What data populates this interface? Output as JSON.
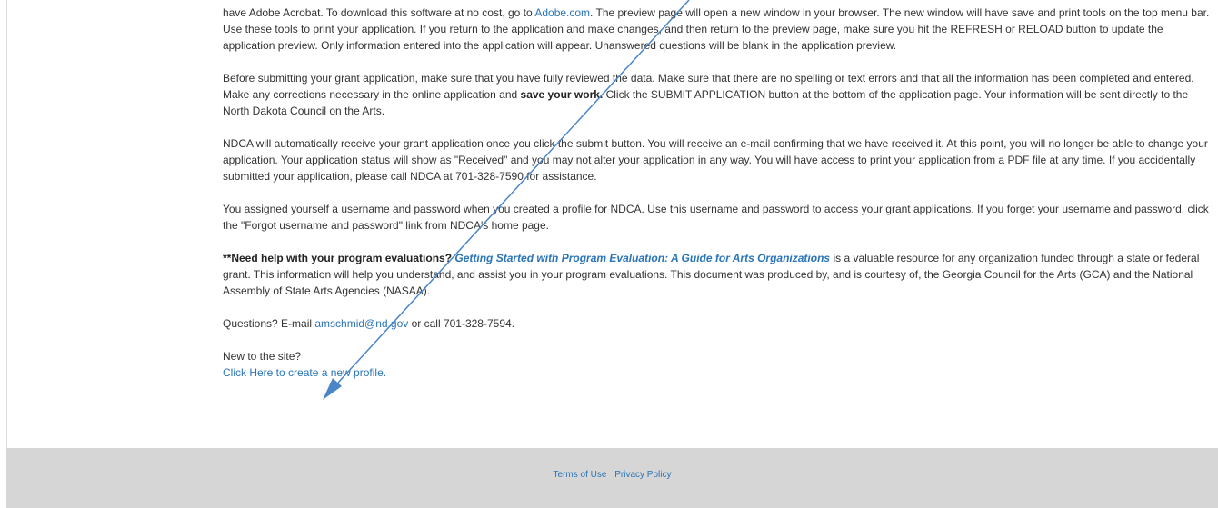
{
  "intro": {
    "p1_a": "have Adobe Acrobat. To download this software at no cost, go to ",
    "p1_link": "Adobe.com",
    "p1_b": ". The preview page will open a new window in your browser. The new window will have save and print tools on the top menu bar. Use these tools to print your application. If you return to the application and make changes, and then return to the preview page, make sure you hit the REFRESH or RELOAD button to update the application preview. Only information entered into the application will appear. Unanswered questions will be blank in the application preview."
  },
  "submit": {
    "p2_a": "Before submitting your grant application, make sure that you have fully reviewed the data. Make sure that there are no spelling or text errors and that all the information has been completed and entered. Make any corrections necessary in the online application and ",
    "p2_bold": "save your work.",
    "p2_b": " Click the SUBMIT APPLICATION button at the bottom of the application page. Your information will be sent directly to the North Dakota Council on the Arts."
  },
  "received": {
    "p3": "NDCA will automatically receive your grant application once you click the submit button. You will receive an e-mail confirming that we have received it. At this point, you will no longer be able to change your application. Your application status will show as \"Received\" and you may not alter your application in any way. You will have access to print your application from a PDF file at any time. If you accidentally submitted your application, please call NDCA at 701-328-7590 for assistance."
  },
  "login": {
    "p4": "You assigned yourself a username and password when you created a profile for NDCA. Use this username and password to access your grant applications. If you forget your username and password, click the \"Forgot username and password\" link from NDCA's home page."
  },
  "evaluation": {
    "p5_bold": "**Need help with your program evaluations?",
    "p5_link": "Getting Started with Program Evaluation: A Guide for Arts Organizations",
    "p5_b": " is a valuable resource for any organization funded through a state or federal grant. This information will help you understand, and assist you in your program evaluations. This document was produced by, and is courtesy of, the Georgia Council for the Arts (GCA) and the National Assembly of State Arts Agencies (NASAA)."
  },
  "questions": {
    "prefix": "Questions? E-mail ",
    "email": "amschmid@nd.gov",
    "suffix": " or call 701-328-7594."
  },
  "new_user": {
    "label": "New to the site?",
    "link": "Click Here to create a new profile."
  },
  "footer": {
    "terms": "Terms of Use",
    "privacy": "Privacy Policy"
  },
  "colors": {
    "link": "#2a74b8",
    "footer_bg": "#d6d6d6",
    "annotation_arrow": "#4a86c8"
  }
}
